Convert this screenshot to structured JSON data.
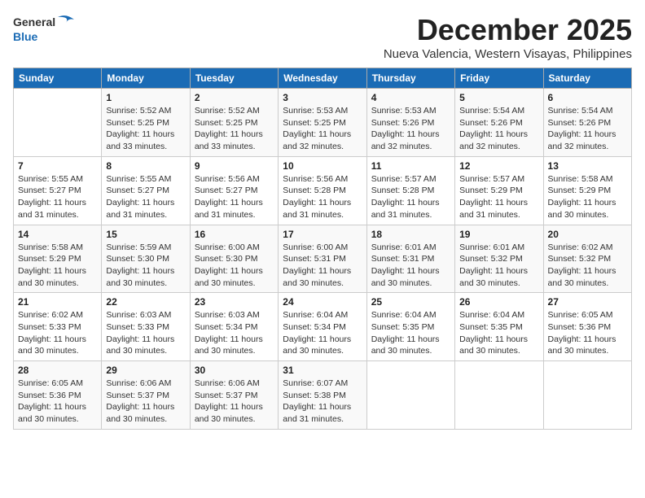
{
  "logo": {
    "general": "General",
    "blue": "Blue"
  },
  "title": "December 2025",
  "subtitle": "Nueva Valencia, Western Visayas, Philippines",
  "days_header": [
    "Sunday",
    "Monday",
    "Tuesday",
    "Wednesday",
    "Thursday",
    "Friday",
    "Saturday"
  ],
  "weeks": [
    [
      {
        "day": "",
        "info": ""
      },
      {
        "day": "1",
        "info": "Sunrise: 5:52 AM\nSunset: 5:25 PM\nDaylight: 11 hours\nand 33 minutes."
      },
      {
        "day": "2",
        "info": "Sunrise: 5:52 AM\nSunset: 5:25 PM\nDaylight: 11 hours\nand 33 minutes."
      },
      {
        "day": "3",
        "info": "Sunrise: 5:53 AM\nSunset: 5:25 PM\nDaylight: 11 hours\nand 32 minutes."
      },
      {
        "day": "4",
        "info": "Sunrise: 5:53 AM\nSunset: 5:26 PM\nDaylight: 11 hours\nand 32 minutes."
      },
      {
        "day": "5",
        "info": "Sunrise: 5:54 AM\nSunset: 5:26 PM\nDaylight: 11 hours\nand 32 minutes."
      },
      {
        "day": "6",
        "info": "Sunrise: 5:54 AM\nSunset: 5:26 PM\nDaylight: 11 hours\nand 32 minutes."
      }
    ],
    [
      {
        "day": "7",
        "info": "Sunrise: 5:55 AM\nSunset: 5:27 PM\nDaylight: 11 hours\nand 31 minutes."
      },
      {
        "day": "8",
        "info": "Sunrise: 5:55 AM\nSunset: 5:27 PM\nDaylight: 11 hours\nand 31 minutes."
      },
      {
        "day": "9",
        "info": "Sunrise: 5:56 AM\nSunset: 5:27 PM\nDaylight: 11 hours\nand 31 minutes."
      },
      {
        "day": "10",
        "info": "Sunrise: 5:56 AM\nSunset: 5:28 PM\nDaylight: 11 hours\nand 31 minutes."
      },
      {
        "day": "11",
        "info": "Sunrise: 5:57 AM\nSunset: 5:28 PM\nDaylight: 11 hours\nand 31 minutes."
      },
      {
        "day": "12",
        "info": "Sunrise: 5:57 AM\nSunset: 5:29 PM\nDaylight: 11 hours\nand 31 minutes."
      },
      {
        "day": "13",
        "info": "Sunrise: 5:58 AM\nSunset: 5:29 PM\nDaylight: 11 hours\nand 30 minutes."
      }
    ],
    [
      {
        "day": "14",
        "info": "Sunrise: 5:58 AM\nSunset: 5:29 PM\nDaylight: 11 hours\nand 30 minutes."
      },
      {
        "day": "15",
        "info": "Sunrise: 5:59 AM\nSunset: 5:30 PM\nDaylight: 11 hours\nand 30 minutes."
      },
      {
        "day": "16",
        "info": "Sunrise: 6:00 AM\nSunset: 5:30 PM\nDaylight: 11 hours\nand 30 minutes."
      },
      {
        "day": "17",
        "info": "Sunrise: 6:00 AM\nSunset: 5:31 PM\nDaylight: 11 hours\nand 30 minutes."
      },
      {
        "day": "18",
        "info": "Sunrise: 6:01 AM\nSunset: 5:31 PM\nDaylight: 11 hours\nand 30 minutes."
      },
      {
        "day": "19",
        "info": "Sunrise: 6:01 AM\nSunset: 5:32 PM\nDaylight: 11 hours\nand 30 minutes."
      },
      {
        "day": "20",
        "info": "Sunrise: 6:02 AM\nSunset: 5:32 PM\nDaylight: 11 hours\nand 30 minutes."
      }
    ],
    [
      {
        "day": "21",
        "info": "Sunrise: 6:02 AM\nSunset: 5:33 PM\nDaylight: 11 hours\nand 30 minutes."
      },
      {
        "day": "22",
        "info": "Sunrise: 6:03 AM\nSunset: 5:33 PM\nDaylight: 11 hours\nand 30 minutes."
      },
      {
        "day": "23",
        "info": "Sunrise: 6:03 AM\nSunset: 5:34 PM\nDaylight: 11 hours\nand 30 minutes."
      },
      {
        "day": "24",
        "info": "Sunrise: 6:04 AM\nSunset: 5:34 PM\nDaylight: 11 hours\nand 30 minutes."
      },
      {
        "day": "25",
        "info": "Sunrise: 6:04 AM\nSunset: 5:35 PM\nDaylight: 11 hours\nand 30 minutes."
      },
      {
        "day": "26",
        "info": "Sunrise: 6:04 AM\nSunset: 5:35 PM\nDaylight: 11 hours\nand 30 minutes."
      },
      {
        "day": "27",
        "info": "Sunrise: 6:05 AM\nSunset: 5:36 PM\nDaylight: 11 hours\nand 30 minutes."
      }
    ],
    [
      {
        "day": "28",
        "info": "Sunrise: 6:05 AM\nSunset: 5:36 PM\nDaylight: 11 hours\nand 30 minutes."
      },
      {
        "day": "29",
        "info": "Sunrise: 6:06 AM\nSunset: 5:37 PM\nDaylight: 11 hours\nand 30 minutes."
      },
      {
        "day": "30",
        "info": "Sunrise: 6:06 AM\nSunset: 5:37 PM\nDaylight: 11 hours\nand 30 minutes."
      },
      {
        "day": "31",
        "info": "Sunrise: 6:07 AM\nSunset: 5:38 PM\nDaylight: 11 hours\nand 31 minutes."
      },
      {
        "day": "",
        "info": ""
      },
      {
        "day": "",
        "info": ""
      },
      {
        "day": "",
        "info": ""
      }
    ]
  ]
}
